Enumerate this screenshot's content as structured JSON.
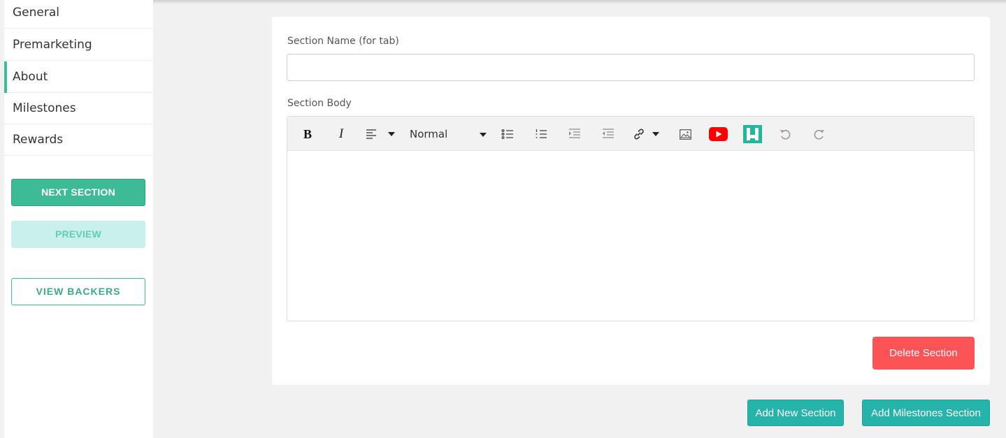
{
  "sidebar": {
    "items": [
      {
        "label": "General"
      },
      {
        "label": "Premarketing"
      },
      {
        "label": "About",
        "active": true
      },
      {
        "label": "Milestones"
      },
      {
        "label": "Rewards"
      }
    ],
    "next_section_label": "NEXT SECTION",
    "preview_label": "PREVIEW",
    "view_backers_label": "VIEW BACKERS"
  },
  "form": {
    "section_name_label": "Section Name (for tab)",
    "section_name_value": "",
    "section_body_label": "Section Body",
    "section_body_value": ""
  },
  "toolbar": {
    "bold": "B",
    "italic": "I",
    "text_size_selected": "Normal",
    "icons": [
      "bold-icon",
      "italic-icon",
      "align-left-icon",
      "bullet-list-icon",
      "numbered-list-icon",
      "indent-icon",
      "outdent-icon",
      "link-icon",
      "image-icon",
      "youtube-icon",
      "embed-logo-icon",
      "undo-icon",
      "redo-icon"
    ]
  },
  "actions": {
    "delete_section_label": "Delete Section",
    "add_new_section_label": "Add New Section",
    "add_milestones_section_label": "Add Milestones Section"
  },
  "colors": {
    "accent": "#3dbb96",
    "preview_bg": "#c9f0ea",
    "delete": "#fb5356",
    "teal_button": "#26b3aa",
    "youtube": "#ff0000",
    "embed_logo": "#1fb89a"
  }
}
